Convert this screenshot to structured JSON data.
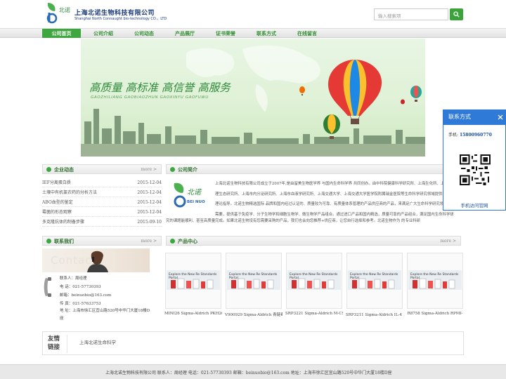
{
  "header": {
    "company_cn": "上海北诺生物科技有限公司",
    "company_en": "Shanghai North Connaught bio-technology CO.，LTD",
    "logo_mark_text": "北诺",
    "search_placeholder": "输入搜索项"
  },
  "nav": {
    "items": [
      {
        "label": "公司首页"
      },
      {
        "label": "公司介绍"
      },
      {
        "label": "公司动态"
      },
      {
        "label": "产品展厅"
      },
      {
        "label": "证书荣誉"
      },
      {
        "label": "联系方式"
      },
      {
        "label": "在线留言"
      }
    ]
  },
  "banner": {
    "slogan": "高质量 高标准 高信誉 高服务",
    "slogan_pinyin": "GAOZHILIANG  GAOBIAOZHUN  GAOXINYU  GAOFUWU"
  },
  "news": {
    "title": "企业动态",
    "more": "more >",
    "items": [
      {
        "title": "IEF分离蛋白质",
        "date": "2015-12-04"
      },
      {
        "title": "土壤中有机氯农药的分析方法",
        "date": "2015-12-04"
      },
      {
        "title": "ABO血型的鉴定",
        "date": "2015-12-04"
      },
      {
        "title": "霉菌的形态观察",
        "date": "2015-12-04"
      },
      {
        "title": "多克隆抗体的制备步骤",
        "date": "2015-09-10"
      }
    ]
  },
  "intro": {
    "title": "公司简介",
    "logo_cn": "北诺",
    "logo_en": "BEI NUO",
    "text": "上海北诺生物科技有限公司成立于2007年,是由留美生物医学界 与国内生命科学界 共同创办。由中科院健康科学研究所、上海生化所、上海植物生理生态研究所、上海市内分泌研究所、上海市血液学研究所、上海交通大学、上海交通大学医学院附属瑞金医院等生命科学研究领域提供技术支持和理论指导。北诺生物精选国际 品牌和国内经过认证的、质量较为可靠、有质量体系管理的产品供应商的产品，来满足广大生命科学研究领域 的课题需要，提供基于免疫学、分子生物学和细胞生物学、微生物学产品组合。通过进口产品和国内精选，质量可靠的产品组合，满足国内生命科学研",
    "tail": "究的课题能顺利、甚至高质量完成。如果北诺生物没有您需要采购的产品，我们也会向您推荐+供应商，让您自行选择和参考。北诺生物作为 的专业科研"
  },
  "contact": {
    "title": "联系我们",
    "more": "more >",
    "image_word": "Contact",
    "person": "联系人：周经理",
    "tel": "电  话：021-57730393",
    "email": "邮箱：beinuobio@163.com",
    "fax": "传  真：021-57633753",
    "address_1": "地    址：上海市徐汇区宜山路520号中华门大厦18楼D",
    "address_2": "座"
  },
  "products": {
    "title": "产品中心",
    "more": "more >",
    "thumb_title": "Explore the New Re Standards Portal",
    "items": [
      {
        "caption": "MINI26 Sigma-Aldrich PKH26"
      },
      {
        "caption": "V900929 Sigma-Aldrich 青链霉"
      },
      {
        "caption": "SRP3221 Sigma-Aldrich M-CSF"
      },
      {
        "caption": "SRP3211 Sigma-Aldrich IL-4 来"
      },
      {
        "caption": "R8758 Sigma-Aldrich RPMI-"
      }
    ]
  },
  "links": {
    "title": "友情链接",
    "items": [
      "上海北诺生命科学"
    ]
  },
  "footer": {
    "text": "上海北诺生物科技有限公司    联系人：周经理    电话：021-57730393      邮箱：beinuobio@163.com      地址：上海市徐汇区宜山路520号中华门大厦18楼D座"
  },
  "float_panel": {
    "title": "联系方式",
    "phone_label": "手机:",
    "phone": "15800960770",
    "mobile_link": "手机访问官网"
  },
  "colors": {
    "brand_green": "#3ea63e",
    "float_blue": "#2f7ad6"
  }
}
